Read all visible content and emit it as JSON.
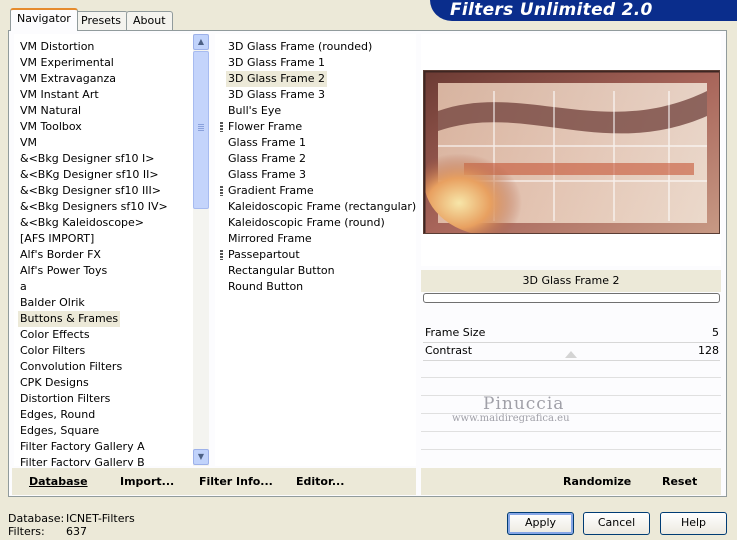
{
  "header": {
    "title": "Filters Unlimited 2.0",
    "color": "#0a2d8c"
  },
  "tabs": [
    {
      "label": "Navigator",
      "active": true
    },
    {
      "label": "Presets",
      "active": false
    },
    {
      "label": "About",
      "active": false
    }
  ],
  "categories": [
    {
      "label": "VM Distortion"
    },
    {
      "label": "VM Experimental"
    },
    {
      "label": "VM Extravaganza"
    },
    {
      "label": "VM Instant Art"
    },
    {
      "label": "VM Natural"
    },
    {
      "label": "VM Toolbox"
    },
    {
      "label": "VM"
    },
    {
      "label": "&<Bkg Designer sf10 I>"
    },
    {
      "label": "&<BKg Designer sf10 II>"
    },
    {
      "label": "&<Bkg Designer sf10 III>"
    },
    {
      "label": "&<Bkg Designers sf10 IV>"
    },
    {
      "label": "&<Bkg Kaleidoscope>"
    },
    {
      "label": "[AFS IMPORT]"
    },
    {
      "label": "Alf's Border FX"
    },
    {
      "label": "Alf's Power Toys"
    },
    {
      "label": "a"
    },
    {
      "label": "Balder Olrik"
    },
    {
      "label": "Buttons & Frames",
      "selected": true
    },
    {
      "label": "Color Effects"
    },
    {
      "label": "Color Filters"
    },
    {
      "label": "Convolution Filters"
    },
    {
      "label": "CPK Designs"
    },
    {
      "label": "Distortion Filters"
    },
    {
      "label": "Edges, Round"
    },
    {
      "label": "Edges, Square"
    },
    {
      "label": "Filter Factory Gallery A"
    },
    {
      "label": "Filter Factory Gallery B"
    }
  ],
  "filters": [
    {
      "label": "3D Glass Frame (rounded)"
    },
    {
      "label": "3D Glass Frame 1"
    },
    {
      "label": "3D Glass Frame 2",
      "selected": true
    },
    {
      "label": "3D Glass Frame 3"
    },
    {
      "label": "Bull's Eye"
    },
    {
      "label": "Flower Frame",
      "grip": true
    },
    {
      "label": "Glass Frame 1"
    },
    {
      "label": "Glass Frame 2"
    },
    {
      "label": "Glass Frame 3"
    },
    {
      "label": "Gradient Frame",
      "grip": true
    },
    {
      "label": "Kaleidoscopic Frame (rectangular)"
    },
    {
      "label": "Kaleidoscopic Frame (round)"
    },
    {
      "label": "Mirrored Frame"
    },
    {
      "label": "Passepartout",
      "grip": true
    },
    {
      "label": "Rectangular Button"
    },
    {
      "label": "Round Button"
    }
  ],
  "selected_filter": "3D Glass Frame 2",
  "progress": 0,
  "params": [
    {
      "label": "Frame Size",
      "value": "5"
    },
    {
      "label": "Contrast",
      "value": "128"
    }
  ],
  "watermark": {
    "name": "Pinuccia",
    "url": "www.maidiregrafica.eu"
  },
  "left_bar": {
    "database": "Database",
    "import": "Import...",
    "filter_info": "Filter Info...",
    "editor": "Editor..."
  },
  "right_bar": {
    "randomize": "Randomize",
    "reset": "Reset"
  },
  "status": {
    "database_label": "Database:",
    "database_value": "ICNET-Filters",
    "filters_label": "Filters:",
    "filters_value": "637"
  },
  "buttons": {
    "apply": "Apply",
    "cancel": "Cancel",
    "help": "Help"
  }
}
